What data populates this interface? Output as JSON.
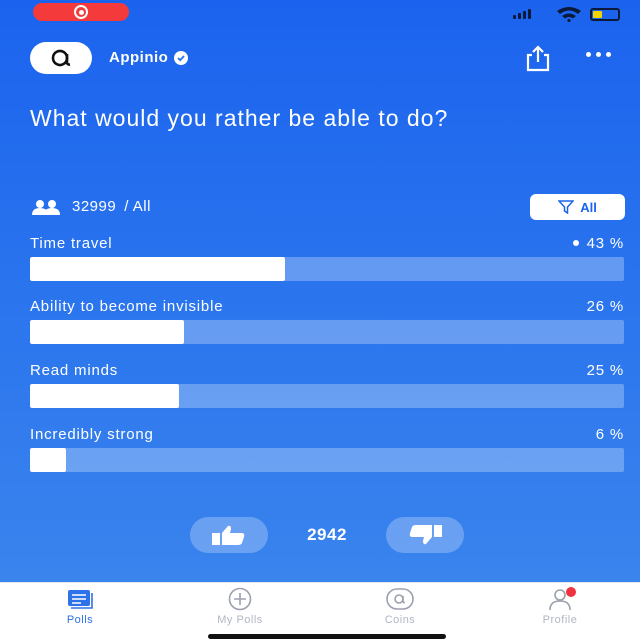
{
  "status_bar": {
    "record_icon": "record-icon",
    "signal_icon": "signal-icon",
    "wifi_icon": "wifi-icon",
    "battery_icon": "battery-icon"
  },
  "header": {
    "brand_name": "Appinio",
    "verified_icon": "verified-check-icon",
    "share_icon": "share-icon",
    "more_icon": "more-dots-icon"
  },
  "poll": {
    "question": "What would you rather be able to do?",
    "participants": "32999",
    "audience": "/ All",
    "filter_label": "All",
    "options": [
      {
        "label": "Time travel",
        "percent_text": "43 %",
        "percent": 43,
        "selected": true
      },
      {
        "label": "Ability to become invisible",
        "percent_text": "26 %",
        "percent": 26,
        "selected": false
      },
      {
        "label": "Read minds",
        "percent_text": "25 %",
        "percent": 25,
        "selected": false
      },
      {
        "label": "Incredibly strong",
        "percent_text": "6 %",
        "percent": 6,
        "selected": false
      }
    ],
    "vote_count": "2942"
  },
  "tabbar": {
    "tabs": [
      {
        "label": "Polls",
        "icon": "polls-icon",
        "active": true
      },
      {
        "label": "My Polls",
        "icon": "plus-circle-icon",
        "active": false
      },
      {
        "label": "Coins",
        "icon": "coin-icon",
        "active": false
      },
      {
        "label": "Profile",
        "icon": "profile-icon",
        "active": false
      }
    ]
  },
  "colors": {
    "primary": "#1b63ee",
    "accent_red": "#ef3340",
    "inactive": "#b0b6c2"
  }
}
